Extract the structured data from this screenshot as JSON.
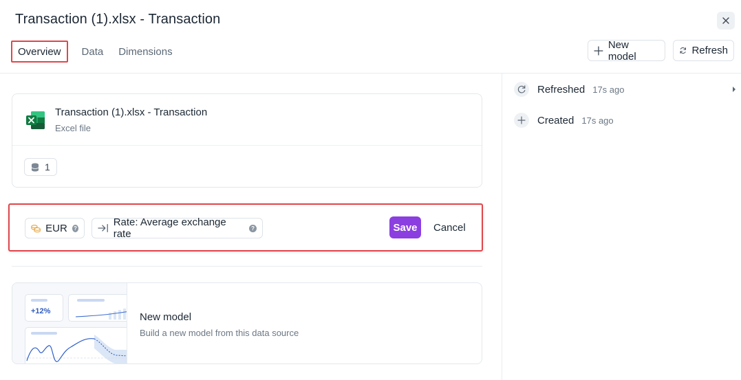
{
  "header": {
    "title": "Transaction (1).xlsx - Transaction",
    "close_icon": "close-icon"
  },
  "tabs": [
    {
      "label": "Overview",
      "active": true
    },
    {
      "label": "Data",
      "active": false
    },
    {
      "label": "Dimensions",
      "active": false
    }
  ],
  "actions": {
    "new_model_label": "New model",
    "refresh_label": "Refresh"
  },
  "file_card": {
    "name": "Transaction (1).xlsx - Transaction",
    "type": "Excel file",
    "icon": "excel-icon",
    "table_count": "1"
  },
  "currency_edit": {
    "currency": "EUR",
    "rate_label": "Rate: Average exchange rate",
    "save_label": "Save",
    "cancel_label": "Cancel"
  },
  "model_card": {
    "illustration_stat": "+12%",
    "title": "New model",
    "description": "Build a new model from this data source"
  },
  "activity": [
    {
      "label": "Refreshed",
      "time": "17s ago",
      "icon": "refresh-icon"
    },
    {
      "label": "Created",
      "time": "17s ago",
      "icon": "plus-icon"
    }
  ],
  "colors": {
    "accent": "#8b3fe0",
    "highlight": "#e0454b",
    "excel": "#1d7a45",
    "currency_icon": "#e6a23c"
  }
}
